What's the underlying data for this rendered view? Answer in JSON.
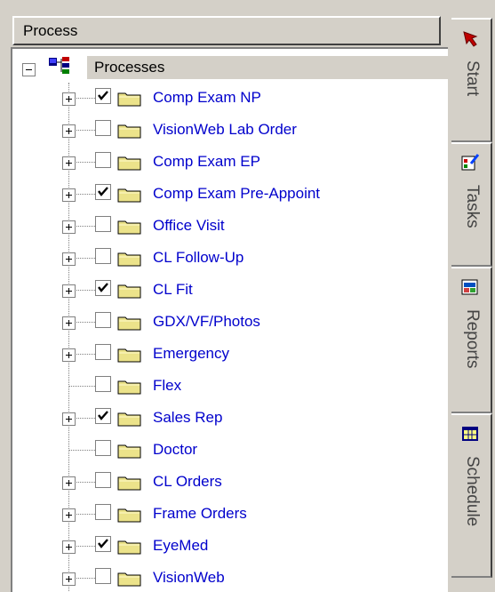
{
  "panel": {
    "title": "Process"
  },
  "tree": {
    "root": {
      "label": "Processes",
      "expanded": true
    },
    "items": [
      {
        "label": "Comp Exam NP",
        "checked": true,
        "expandable": true
      },
      {
        "label": "VisionWeb Lab Order",
        "checked": false,
        "expandable": true
      },
      {
        "label": "Comp Exam EP",
        "checked": false,
        "expandable": true
      },
      {
        "label": "Comp Exam Pre-Appoint",
        "checked": true,
        "expandable": true
      },
      {
        "label": "Office Visit",
        "checked": false,
        "expandable": true
      },
      {
        "label": "CL Follow-Up",
        "checked": false,
        "expandable": true
      },
      {
        "label": "CL Fit",
        "checked": true,
        "expandable": true
      },
      {
        "label": "GDX/VF/Photos",
        "checked": false,
        "expandable": true
      },
      {
        "label": "Emergency",
        "checked": false,
        "expandable": true
      },
      {
        "label": "Flex",
        "checked": false,
        "expandable": false
      },
      {
        "label": "Sales Rep",
        "checked": true,
        "expandable": true
      },
      {
        "label": "Doctor",
        "checked": false,
        "expandable": false
      },
      {
        "label": "CL Orders",
        "checked": false,
        "expandable": true
      },
      {
        "label": "Frame Orders",
        "checked": false,
        "expandable": true
      },
      {
        "label": "EyeMed",
        "checked": true,
        "expandable": true
      },
      {
        "label": "VisionWeb",
        "checked": false,
        "expandable": true
      }
    ]
  },
  "tabs": [
    {
      "label": "Start",
      "icon": "arrow-icon",
      "active": true
    },
    {
      "label": "Tasks",
      "icon": "tasks-icon",
      "active": false
    },
    {
      "label": "Reports",
      "icon": "reports-icon",
      "active": false
    },
    {
      "label": "Schedule",
      "icon": "schedule-icon",
      "active": false
    }
  ],
  "colors": {
    "link": "#0000cc",
    "folder": "#ece38a",
    "chrome": "#d4d0c8"
  }
}
